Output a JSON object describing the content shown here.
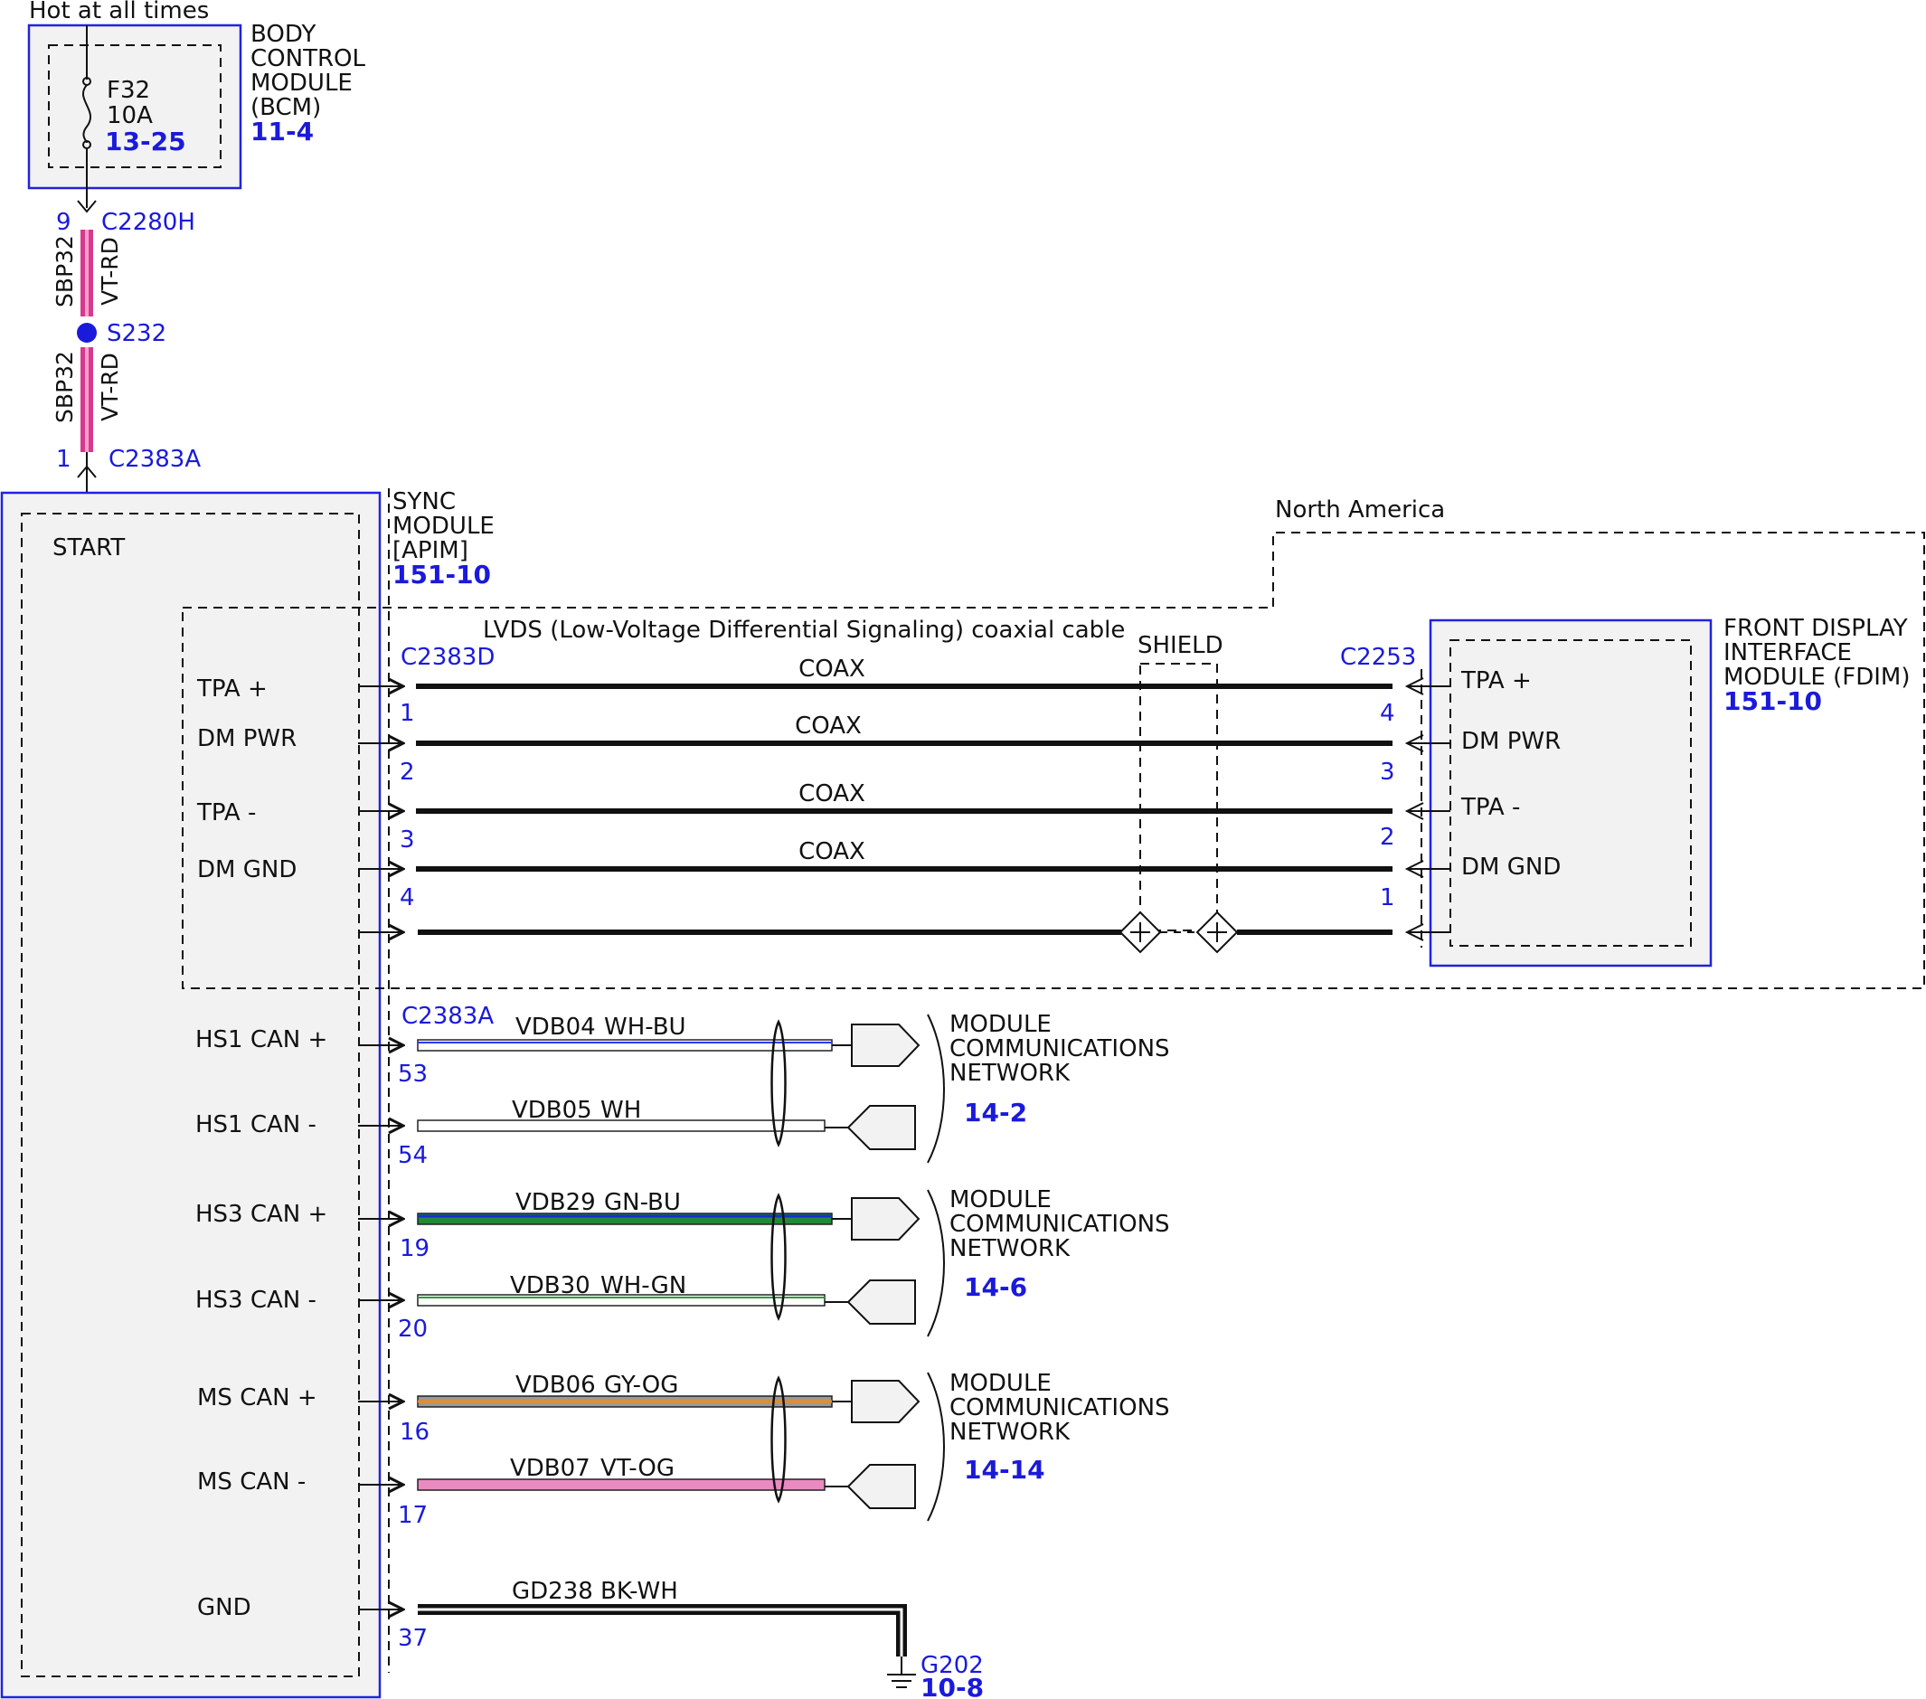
{
  "top": {
    "hot_label": "Hot at all times"
  },
  "bcm": {
    "name_lines": [
      "BODY",
      "CONTROL",
      "MODULE",
      "(BCM)"
    ],
    "ref": "11-4",
    "fuse_id": "F32",
    "fuse_rating": "10A",
    "fuse_ref": "13-25"
  },
  "feed": {
    "connector_top": "C2280H",
    "pin_top": "9",
    "circuit_upper": "SBP32",
    "color_upper": "VT-RD",
    "splice": "S232",
    "circuit_lower": "SBP32",
    "color_lower": "VT-RD",
    "connector_bottom": "C2383A",
    "pin_bottom": "1"
  },
  "sync": {
    "name_lines": [
      "SYNC",
      "MODULE",
      "[APIM]"
    ],
    "ref": "151-10",
    "start": "START"
  },
  "lvds": {
    "region": "North America",
    "cable_label": "LVDS (Low-Voltage Differential Signaling) coaxial cable",
    "shield_label": "SHIELD",
    "left_connector": "C2383D",
    "right_connector": "C2253",
    "coax_label": "COAX",
    "pins": [
      {
        "left_label": "TPA +",
        "left_pin": "1",
        "right_pin": "4",
        "right_label": "TPA +"
      },
      {
        "left_label": "DM PWR",
        "left_pin": "2",
        "right_pin": "3",
        "right_label": "DM PWR"
      },
      {
        "left_label": "TPA -",
        "left_pin": "3",
        "right_pin": "2",
        "right_label": "TPA -"
      },
      {
        "left_label": "DM GND",
        "left_pin": "4",
        "right_pin": "1",
        "right_label": "DM GND"
      }
    ]
  },
  "fdim": {
    "name_lines": [
      "FRONT DISPLAY",
      "INTERFACE",
      "MODULE (FDIM)"
    ],
    "ref": "151-10"
  },
  "can": {
    "connector": "C2383A",
    "network_lines": [
      "MODULE",
      "COMMUNICATIONS",
      "NETWORK"
    ],
    "groups": [
      {
        "ref": "14-2",
        "wires": [
          {
            "label": "HS1 CAN +",
            "pin": "53",
            "circuit": "VDB04",
            "color": "WH-BU",
            "base": "#ffffff",
            "stripe": "#2a3cff"
          },
          {
            "label": "HS1 CAN -",
            "pin": "54",
            "circuit": "VDB05",
            "color": "WH",
            "base": "#ffffff",
            "stripe": "#ffffff"
          }
        ]
      },
      {
        "ref": "14-6",
        "wires": [
          {
            "label": "HS3 CAN +",
            "pin": "19",
            "circuit": "VDB29",
            "color": "GN-BU",
            "base": "#1f8a3a",
            "stripe": "#1a2bd6"
          },
          {
            "label": "HS3 CAN -",
            "pin": "20",
            "circuit": "VDB30",
            "color": "WH-GN",
            "base": "#ffffff",
            "stripe": "#2f9a3f"
          }
        ]
      },
      {
        "ref": "14-14",
        "wires": [
          {
            "label": "MS CAN +",
            "pin": "16",
            "circuit": "VDB06",
            "color": "GY-OG",
            "base": "#9a9a9a",
            "stripe": "#f08a1c"
          },
          {
            "label": "MS CAN -",
            "pin": "17",
            "circuit": "VDB07",
            "color": "VT-OG",
            "base": "#e98bc0",
            "stripe": "#e98bc0"
          }
        ]
      }
    ]
  },
  "ground": {
    "label": "GND",
    "pin": "37",
    "circuit": "GD238",
    "color": "BK-WH",
    "point": "G202",
    "ref": "10-8"
  }
}
